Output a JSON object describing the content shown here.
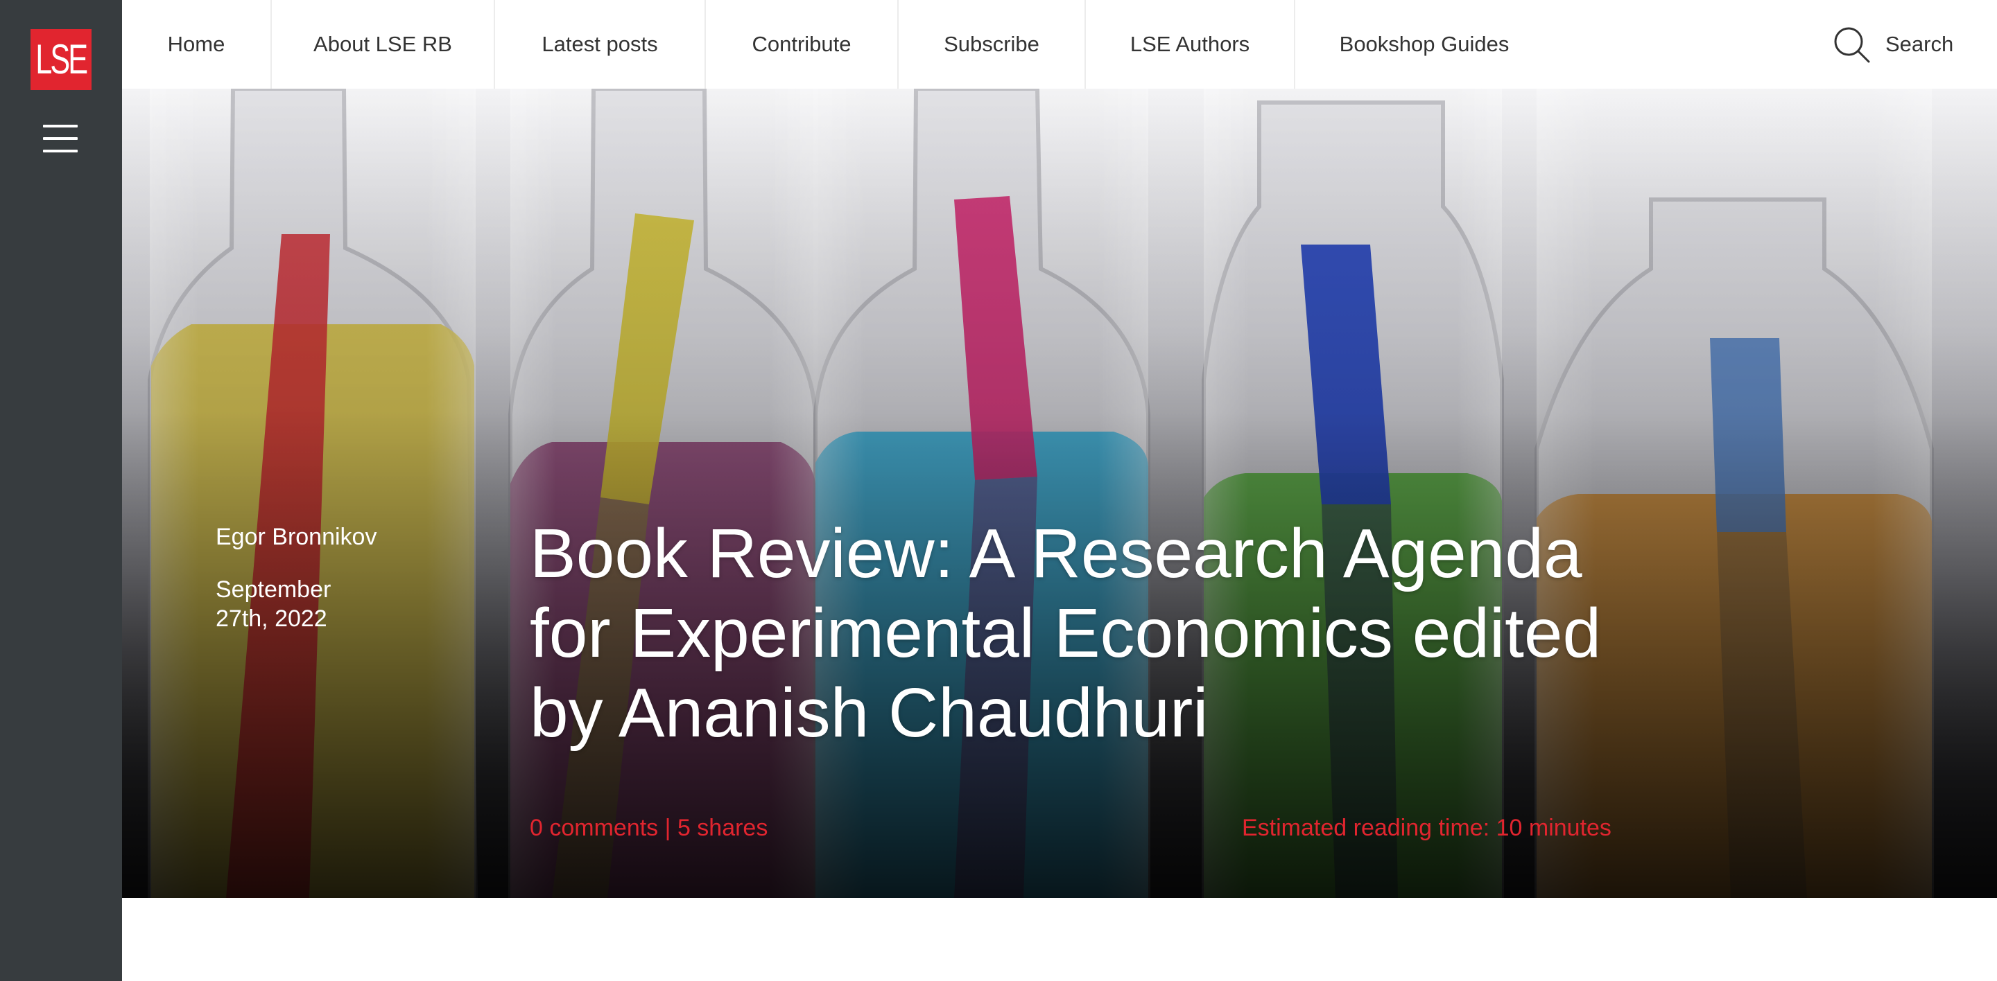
{
  "logo": {
    "text": "LSE",
    "color": "#e1252f"
  },
  "sidebar": {
    "menu_icon": "hamburger-icon",
    "background": "#373c3f"
  },
  "nav": {
    "items": [
      {
        "label": "Home"
      },
      {
        "label": "About LSE RB"
      },
      {
        "label": "Latest posts"
      },
      {
        "label": "Contribute"
      },
      {
        "label": "Subscribe"
      },
      {
        "label": "LSE Authors"
      },
      {
        "label": "Bookshop Guides"
      }
    ],
    "search_label": "Search",
    "search_icon": "search-icon"
  },
  "post": {
    "author": "Egor Bronnikov",
    "date": "September 27th, 2022",
    "title": "Book Review: A Research Agenda for Experimental Economics edited by Ananish Chaudhuri",
    "comments": "0 comments",
    "separator": "|",
    "shares": "5 shares",
    "reading_time": "Estimated reading time: 10 minutes",
    "accent": "#e1252f"
  }
}
